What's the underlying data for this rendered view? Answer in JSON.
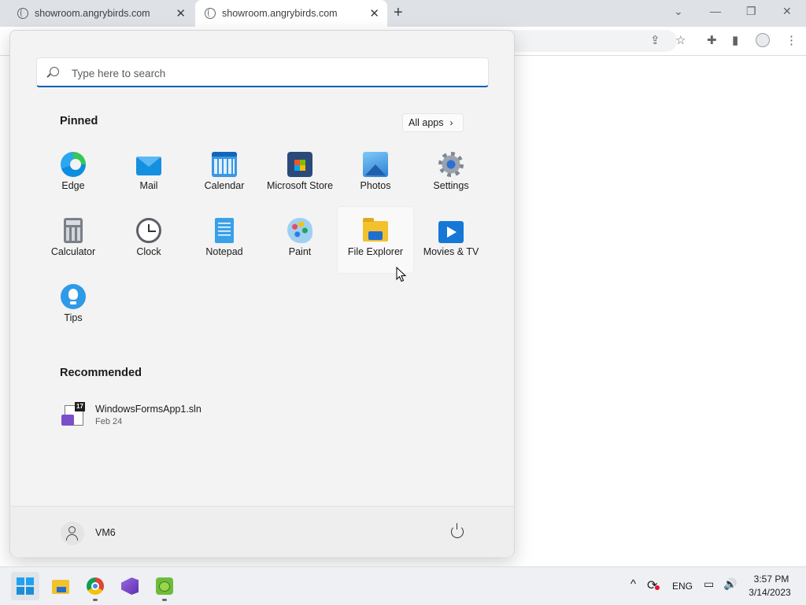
{
  "browser": {
    "tabs": [
      {
        "title": "showroom.angrybirds.com"
      },
      {
        "title": "showroom.angrybirds.com"
      }
    ],
    "new_tab_symbol": "+",
    "close_symbol": "✕",
    "window_controls": {
      "chevron": "⌄",
      "minimize": "—",
      "restore": "❐",
      "close": "✕"
    }
  },
  "start_menu": {
    "search": {
      "placeholder": "Type here to search",
      "value": ""
    },
    "pinned": {
      "title": "Pinned",
      "all_apps_label": "All apps",
      "apps": [
        {
          "label": "Edge",
          "icon": "edge-icon"
        },
        {
          "label": "Mail",
          "icon": "mail-icon"
        },
        {
          "label": "Calendar",
          "icon": "calendar-icon"
        },
        {
          "label": "Microsoft Store",
          "icon": "store-icon"
        },
        {
          "label": "Photos",
          "icon": "photos-icon"
        },
        {
          "label": "Settings",
          "icon": "settings-icon"
        },
        {
          "label": "Calculator",
          "icon": "calculator-icon"
        },
        {
          "label": "Clock",
          "icon": "clock-icon"
        },
        {
          "label": "Notepad",
          "icon": "notepad-icon"
        },
        {
          "label": "Paint",
          "icon": "paint-icon"
        },
        {
          "label": "File Explorer",
          "icon": "file-explorer-icon"
        },
        {
          "label": "Movies & TV",
          "icon": "movies-tv-icon"
        },
        {
          "label": "Tips",
          "icon": "tips-icon"
        }
      ]
    },
    "recommended": {
      "title": "Recommended",
      "items": [
        {
          "name": "WindowsFormsApp1.sln",
          "date": "Feb 24",
          "badge": "17",
          "icon": "visual-studio-solution-icon"
        }
      ]
    },
    "footer": {
      "user_name": "VM6"
    }
  },
  "taskbar": {
    "apps": [
      "start-icon",
      "file-explorer-icon",
      "chrome-icon",
      "visual-studio-icon",
      "angry-birds-icon"
    ],
    "tray": {
      "chevron": "^",
      "language": "ENG",
      "volume_symbol": "🔊",
      "time": "3:57 PM",
      "date": "3/14/2023"
    }
  },
  "colors": {
    "accent": "#005fb8",
    "menu_background": "#f3f3f3",
    "taskbar_background": "#eef0f4"
  }
}
